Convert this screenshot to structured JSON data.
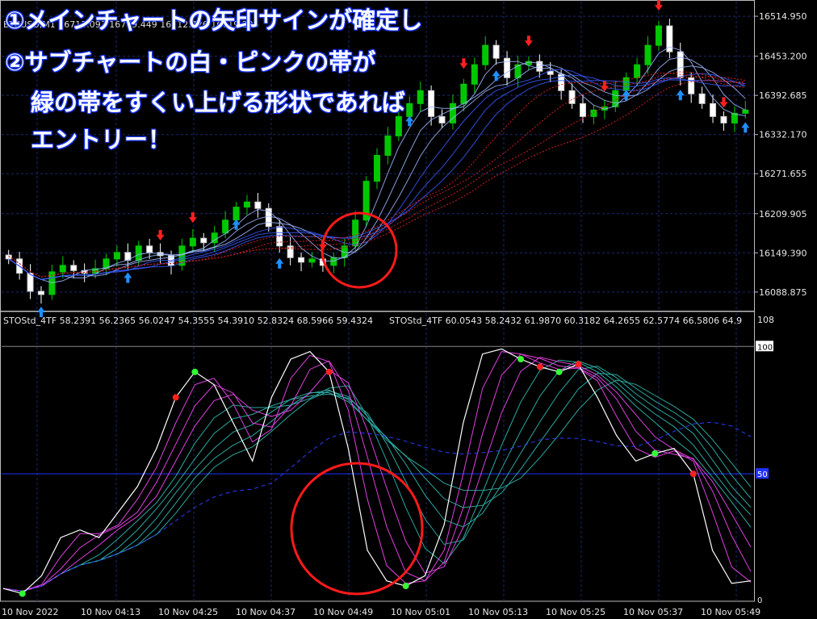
{
  "window": {
    "symbol_line": "BTCUSD,M1 16713.093 16719.449 16712.726 16719.225"
  },
  "annotations": [
    "①メインチャートの矢印サインが確定し",
    "②サブチャートの白・ピンクの帯が",
    "緑の帯をすくい上げる形状であれば",
    "エントリー！"
  ],
  "indicator": {
    "label_1": "STOStd_4TF 58.2391 56.2365 56.0247 54.3555 54.3910 52.8324 68.5966 59.4324",
    "label_2": "STOStd_4TF 60.0543 58.2432 61.9870 60.3182 64.2655 62.5774 66.5806 64.9",
    "level_label": "50",
    "top_label": "108",
    "level_100": "100",
    "bottom_label": "0"
  },
  "colors": {
    "bull_candle": "#00c800",
    "bear_candle": "#ffffff",
    "up_arrow": "#1e90ff",
    "down_arrow": "#ff2020",
    "highlight_circle": "#ff1a1a",
    "grid": "#1a2a70"
  },
  "chart_data": [
    {
      "type": "candlestick",
      "title": "",
      "price_axis": [
        "16514.950",
        "16453.200",
        "16392.685",
        "16332.170",
        "16271.655",
        "16209.905",
        "16149.390",
        "16088.875"
      ],
      "ylim": [
        16060,
        16540
      ],
      "close_path": [
        16140,
        16118,
        16090,
        16085,
        16120,
        16130,
        16122,
        16118,
        16125,
        16140,
        16150,
        16138,
        16160,
        16150,
        16145,
        16130,
        16160,
        16172,
        16165,
        16180,
        16200,
        16220,
        16228,
        16218,
        16190,
        16160,
        16142,
        16135,
        16140,
        16130,
        16142,
        16160,
        16200,
        16260,
        16300,
        16330,
        16360,
        16380,
        16400,
        16360,
        16350,
        16380,
        16410,
        16440,
        16470,
        16450,
        16420,
        16440,
        16445,
        16430,
        16425,
        16400,
        16380,
        16360,
        16370,
        16375,
        16400,
        16420,
        16440,
        16470,
        16500,
        16460,
        16420,
        16395,
        16380,
        16360,
        16350,
        16365,
        16370
      ]
    },
    {
      "type": "line",
      "title": "",
      "ylim": [
        0,
        108
      ],
      "levels": [
        100,
        50,
        0
      ],
      "white_line": [
        5,
        3,
        10,
        25,
        28,
        25,
        35,
        45,
        60,
        80,
        90,
        85,
        70,
        55,
        80,
        95,
        98,
        90,
        60,
        20,
        8,
        6,
        10,
        30,
        70,
        97,
        99,
        95,
        92,
        90,
        93,
        80,
        65,
        55,
        58,
        60,
        50,
        20,
        7,
        8
      ]
    }
  ],
  "time_axis": [
    "10 Nov 2022",
    "10 Nov 04:13",
    "10 Nov 04:25",
    "10 Nov 04:37",
    "10 Nov 04:49",
    "10 Nov 05:01",
    "10 Nov 05:13",
    "10 Nov 05:25",
    "10 Nov 05:37",
    "10 Nov 05:49"
  ]
}
